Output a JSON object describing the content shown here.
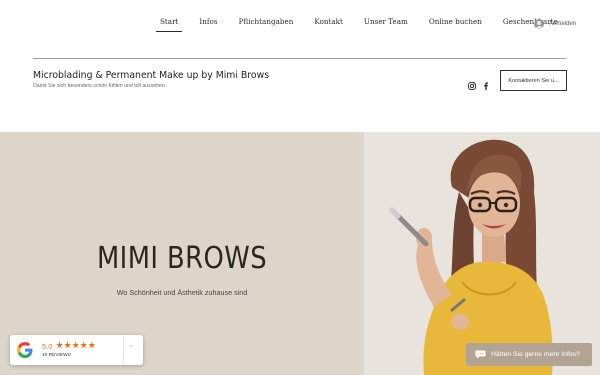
{
  "nav": {
    "items": [
      {
        "label": "Start",
        "active": true
      },
      {
        "label": "Infos",
        "active": false
      },
      {
        "label": "Pflichtangaben",
        "active": false
      },
      {
        "label": "Kontakt",
        "active": false
      },
      {
        "label": "Unser Team",
        "active": false
      },
      {
        "label": "Online buchen",
        "active": false
      },
      {
        "label": "Geschenkkarte",
        "active": false
      }
    ],
    "login_label": "Anmelden"
  },
  "header": {
    "title": "Microblading & Permanent Make up by Mimi Brows",
    "subtitle": "Damit Sie sich besonders schön fühlen und toll aussehen.",
    "social_icons": [
      "instagram-icon",
      "facebook-icon"
    ],
    "contact_button": "Kontaktieren Sie u..."
  },
  "hero": {
    "title": "MIMI BROWS",
    "subtitle": "Wo Schönheit und Ästhetik zuhause sind",
    "left_bg": "#ddd5c9",
    "right_bg": "#e8e3dc"
  },
  "reviews": {
    "score": "5.0",
    "stars": "★★★★★",
    "count": "10 REVIEWS",
    "icon": "google-icon",
    "star_color": "#e7711b"
  },
  "chat": {
    "label": "Hätten Sie gerne mehr Infos?",
    "icon": "chat-bubble-icon",
    "bg": "#b3a393"
  }
}
